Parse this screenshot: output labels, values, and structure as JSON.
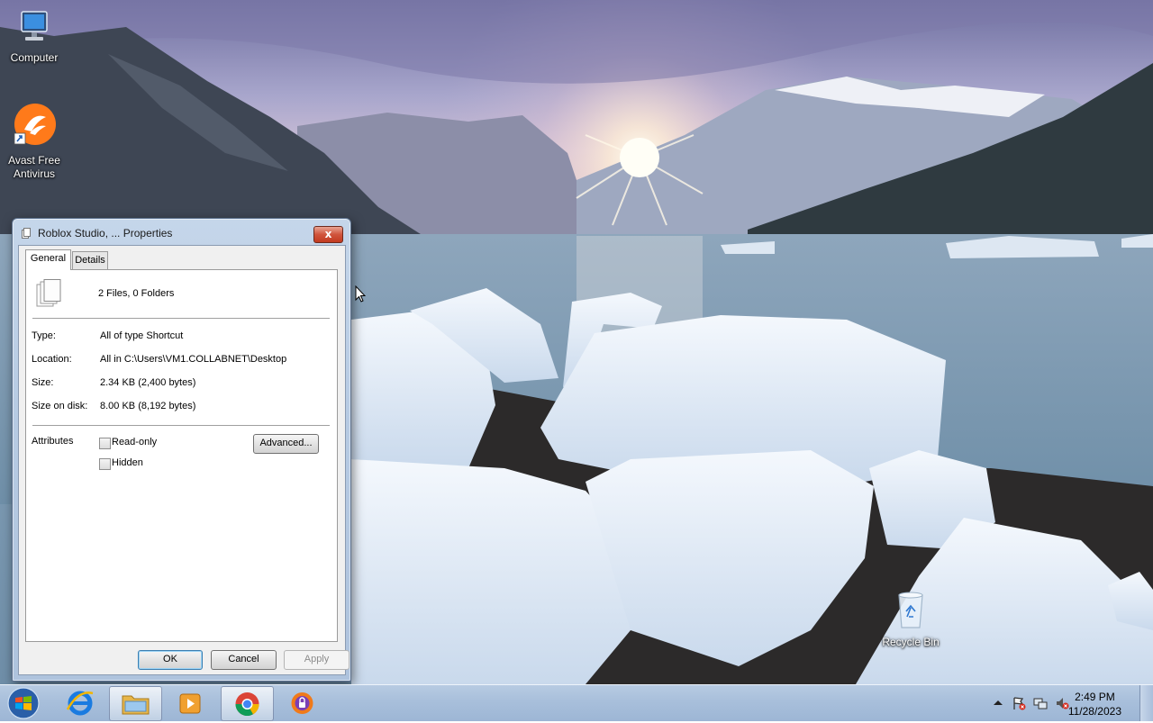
{
  "desktop": {
    "icons": [
      {
        "label_line1": "Computer",
        "label_line2": ""
      },
      {
        "label_line1": "Avast Free",
        "label_line2": "Antivirus"
      },
      {
        "label_line1": "Recycle Bin",
        "label_line2": ""
      }
    ]
  },
  "dialog": {
    "title": "Roblox Studio, ... Properties",
    "close_glyph": "x",
    "tabs": [
      "General",
      "Details"
    ],
    "summary": "2 Files, 0 Folders",
    "fields": [
      {
        "label": "Type:",
        "value": "All of type Shortcut"
      },
      {
        "label": "Location:",
        "value": "All in C:\\Users\\VM1.COLLABNET\\Desktop"
      },
      {
        "label": "Size:",
        "value": "2.34 KB (2,400 bytes)"
      },
      {
        "label": "Size on disk:",
        "value": "8.00 KB (8,192 bytes)"
      }
    ],
    "attributes_label": "Attributes",
    "readonly_label": "Read-only",
    "readonly_checked": false,
    "hidden_label": "Hidden",
    "hidden_checked": false,
    "advanced_label": "Advanced...",
    "ok_label": "OK",
    "cancel_label": "Cancel",
    "apply_label": "Apply"
  },
  "taskbar": {
    "start_icon": "windows-logo-icon",
    "pinned": [
      "internet-explorer-icon",
      "file-explorer-icon",
      "media-player-icon",
      "chrome-icon",
      "avast-secure-browser-icon"
    ],
    "time": "2:49 PM",
    "date": "11/28/2023"
  }
}
